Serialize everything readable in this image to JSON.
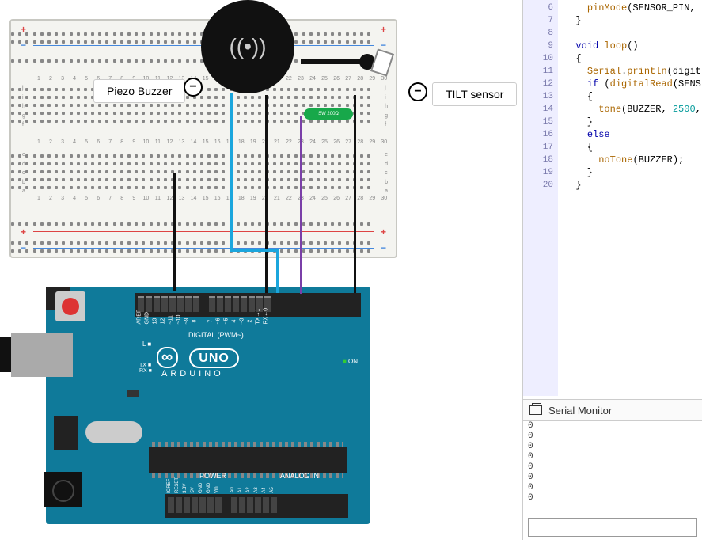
{
  "labels": {
    "piezo": "Piezo Buzzer",
    "tilt": "TILT sensor",
    "neg": "−",
    "buzzer_plus": "+",
    "buzzer_minus": "−",
    "resistor": "SW 200Ω"
  },
  "arduino": {
    "logo": "∞",
    "name": "UNO",
    "brand": "ARDUINO",
    "on": "ON",
    "l": "L",
    "tx": "TX",
    "rx": "RX",
    "digital": "DIGITAL (PWM~)",
    "power": "POWER",
    "analog": "ANALOG IN",
    "top_pins": [
      "AREF",
      "GND",
      "13",
      "12",
      "~11",
      "~10",
      "~9",
      "8",
      "",
      "7",
      "~6",
      "~5",
      "4",
      "~3",
      "2",
      "TX→1",
      "RX←0"
    ],
    "bot_pins": [
      "IOREF",
      "RESET",
      "3.3V",
      "5V",
      "GND",
      "GND",
      "Vin",
      "",
      "A0",
      "A1",
      "A2",
      "A3",
      "A4",
      "A5"
    ]
  },
  "code": {
    "lines": [
      {
        "n": 6,
        "t": "    pinMode(SENSOR_PIN,"
      },
      {
        "n": 7,
        "t": "  }"
      },
      {
        "n": 8,
        "t": ""
      },
      {
        "n": 9,
        "t": "  void loop()"
      },
      {
        "n": 10,
        "t": "  {"
      },
      {
        "n": 11,
        "t": "    Serial.println(digit"
      },
      {
        "n": 12,
        "t": "    if (digitalRead(SENS"
      },
      {
        "n": 13,
        "t": "    {"
      },
      {
        "n": 14,
        "t": "      tone(BUZZER, 2500,"
      },
      {
        "n": 15,
        "t": "    }"
      },
      {
        "n": 16,
        "t": "    else"
      },
      {
        "n": 17,
        "t": "    {"
      },
      {
        "n": 18,
        "t": "      noTone(BUZZER);"
      },
      {
        "n": 19,
        "t": "    }"
      },
      {
        "n": 20,
        "t": "  }"
      }
    ]
  },
  "serial": {
    "title": "Serial Monitor",
    "output": [
      "0",
      "0",
      "0",
      "0",
      "0",
      "0",
      "0",
      "0"
    ]
  },
  "breadboard": {
    "cols": [
      "1",
      "2",
      "3",
      "4",
      "5",
      "6",
      "7",
      "8",
      "9",
      "10",
      "11",
      "12",
      "13",
      "14",
      "15",
      "16",
      "17",
      "18",
      "19",
      "20",
      "21",
      "22",
      "23",
      "24",
      "25",
      "26",
      "27",
      "28",
      "29",
      "30"
    ],
    "rows_top": [
      "j",
      "i",
      "h",
      "g",
      "f"
    ],
    "rows_bot": [
      "e",
      "d",
      "c",
      "b",
      "a"
    ]
  }
}
